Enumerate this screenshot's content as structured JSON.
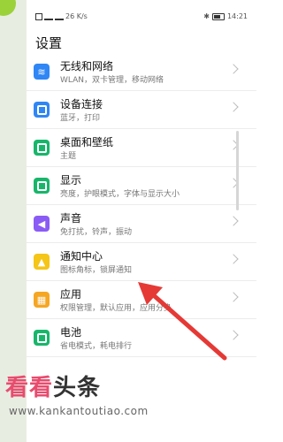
{
  "status_bar": {
    "left_text": "26 K/s",
    "time": "14:21"
  },
  "page": {
    "title": "设置"
  },
  "settings_items": [
    {
      "title": "无线和网络",
      "subtitle": "WLAN，双卡管理，移动网络",
      "icon": "wifi-icon",
      "color": "#2f86f5"
    },
    {
      "title": "设备连接",
      "subtitle": "蓝牙，打印",
      "icon": "device-connect-icon",
      "color": "#2f86f5"
    },
    {
      "title": "桌面和壁纸",
      "subtitle": "主题",
      "icon": "wallpaper-icon",
      "color": "#17b66a"
    },
    {
      "title": "显示",
      "subtitle": "亮度，护眼模式，字体与显示大小",
      "icon": "display-icon",
      "color": "#17b66a"
    },
    {
      "title": "声音",
      "subtitle": "免打扰，铃声，振动",
      "icon": "sound-icon",
      "color": "#8a5cf5"
    },
    {
      "title": "通知中心",
      "subtitle": "图标角标，锁屏通知",
      "icon": "notification-icon",
      "color": "#f5c518"
    },
    {
      "title": "应用",
      "subtitle": "权限管理，默认应用，应用分身",
      "icon": "apps-icon",
      "color": "#f5a623"
    },
    {
      "title": "电池",
      "subtitle": "省电模式，耗电排行",
      "icon": "battery-icon",
      "color": "#17b66a"
    }
  ],
  "watermark": {
    "text_a": "看看",
    "text_b": "头条",
    "url": "www.kankantoutiao.com"
  },
  "accent": "#e53935"
}
